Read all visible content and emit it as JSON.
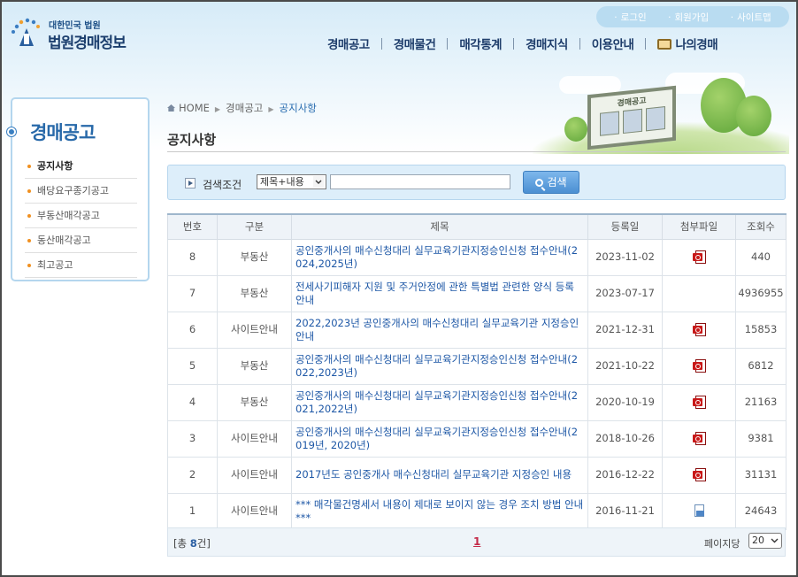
{
  "header": {
    "logo_small": "대한민국 법원",
    "logo_big": "법원경매정보",
    "util_links": [
      "로그인",
      "회원가입",
      "사이트맵"
    ],
    "gnb": [
      "경매공고",
      "경매물건",
      "매각통계",
      "경매지식",
      "이용안내"
    ],
    "gnb_mine": "나의경매",
    "illustration_text": "경매공고"
  },
  "left_menu": {
    "title": "경매공고",
    "items": [
      {
        "label": "공지사항",
        "active": true
      },
      {
        "label": "배당요구종기공고",
        "active": false
      },
      {
        "label": "부동산매각공고",
        "active": false
      },
      {
        "label": "동산매각공고",
        "active": false
      },
      {
        "label": "최고공고",
        "active": false
      }
    ]
  },
  "breadcrumb": [
    "HOME",
    "경매공고",
    "공지사항"
  ],
  "page_title": "공지사항",
  "search": {
    "label": "검색조건",
    "select_value": "제목+내용",
    "input_value": "",
    "button": "검색"
  },
  "table": {
    "headers": [
      "번호",
      "구분",
      "제목",
      "등록일",
      "첨부파일",
      "조회수"
    ],
    "rows": [
      {
        "no": "8",
        "category": "부동산",
        "title": "공인중개사의 매수신청대리 실무교육기관지정승인신청 접수안내(2024,2025년)",
        "date": "2023-11-02",
        "attach": "pdf",
        "views": "440"
      },
      {
        "no": "7",
        "category": "부동산",
        "title": "전세사기피해자 지원 및 주거안정에 관한 특별법 관련한 양식 등록 안내",
        "date": "2023-07-17",
        "attach": "",
        "views": "4936955"
      },
      {
        "no": "6",
        "category": "사이트안내",
        "title": "2022,2023년 공인중개사의 매수신청대리 실무교육기관 지정승인 안내",
        "date": "2021-12-31",
        "attach": "pdf",
        "views": "15853"
      },
      {
        "no": "5",
        "category": "부동산",
        "title": "공인중개사의 매수신청대리 실무교육기관지정승인신청 접수안내(2022,2023년)",
        "date": "2021-10-22",
        "attach": "pdf",
        "views": "6812"
      },
      {
        "no": "4",
        "category": "부동산",
        "title": "공인중개사의 매수신청대리 실무교육기관지정승인신청 접수안내(2021,2022년)",
        "date": "2020-10-19",
        "attach": "pdf",
        "views": "21163"
      },
      {
        "no": "3",
        "category": "사이트안내",
        "title": "공인중개사의 매수신청대리 실무교육기관지정승인신청 접수안내(2019년, 2020년)",
        "date": "2018-10-26",
        "attach": "pdf",
        "views": "9381"
      },
      {
        "no": "2",
        "category": "사이트안내",
        "title": "2017년도 공인중개사 매수신청대리 실무교육기관 지정승인 내용",
        "date": "2016-12-22",
        "attach": "pdf",
        "views": "31131"
      },
      {
        "no": "1",
        "category": "사이트안내",
        "title": "*** 매각물건명세서 내용이 제대로 보이지 않는 경우 조치 방법 안내 ***",
        "date": "2016-11-21",
        "attach": "file",
        "views": "24643"
      }
    ]
  },
  "footer": {
    "total_prefix": "[총 ",
    "total_count": "8",
    "total_suffix": "건]",
    "page": "1",
    "per_page_label": "페이지당",
    "per_page_value": "20"
  },
  "colors": {
    "accent": "#2869a9",
    "link": "#1d57a6",
    "current_page": "#c42b4a"
  }
}
